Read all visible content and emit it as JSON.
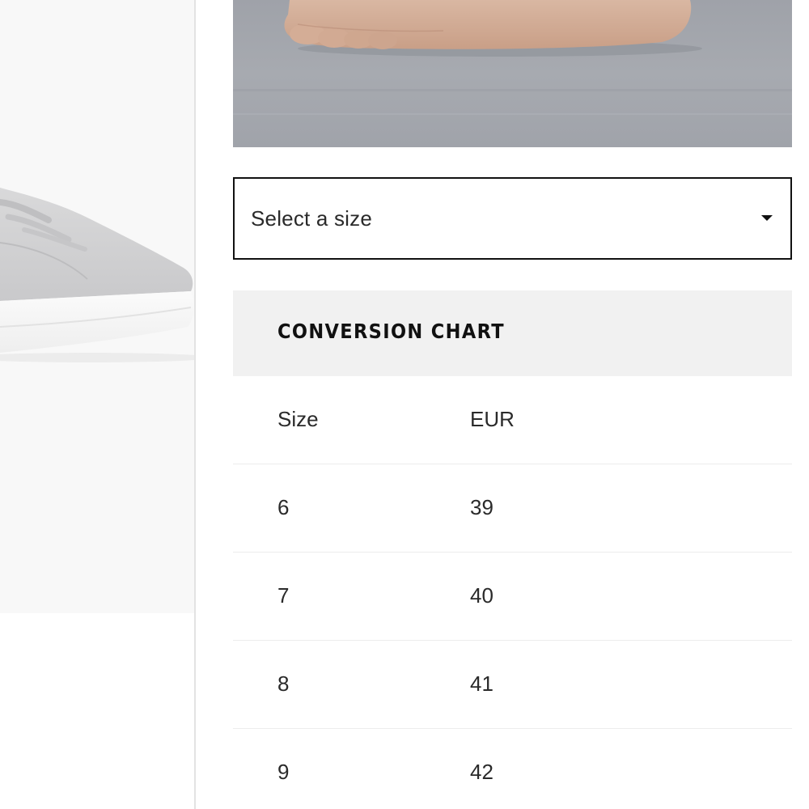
{
  "size_selector": {
    "label": "Select a size",
    "icon": "caret-down-icon"
  },
  "conversion_chart": {
    "title": "CONVERSION CHART",
    "columns": [
      "Size",
      "EUR"
    ],
    "rows": [
      [
        "6",
        "39"
      ],
      [
        "7",
        "40"
      ],
      [
        "8",
        "41"
      ],
      [
        "9",
        "42"
      ]
    ]
  },
  "colors": {
    "border_dark": "#111111",
    "header_bg": "#f1f1f1",
    "row_divider": "#ececec",
    "floor_gray": "#a3a6ad"
  }
}
